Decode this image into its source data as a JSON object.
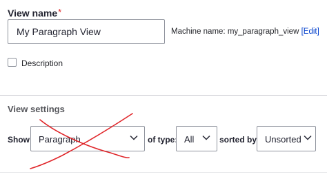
{
  "view_name": {
    "label": "View name",
    "required_marker": "*",
    "value": "My Paragraph View",
    "machine_name_prefix": "Machine name: my_paragraph_view ",
    "edit_label": "[Edit]"
  },
  "description": {
    "label": "Description",
    "checked": false
  },
  "view_settings": {
    "title": "View settings",
    "show_label": "Show:",
    "show_value": "Paragraph",
    "type_label": "of type:",
    "type_value": "All",
    "sorted_label": "sorted by:",
    "sorted_value": "Unsorted"
  },
  "colors": {
    "accent_link": "#003ecc",
    "required": "#dc2323",
    "scribble": "#e0262a"
  }
}
